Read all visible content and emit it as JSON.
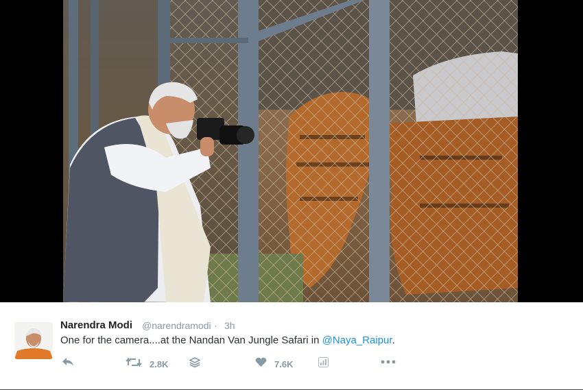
{
  "tweet": {
    "author_name": "Narendra Modi",
    "handle": "@narendramodi",
    "separator": "·",
    "time": "3h",
    "text_before": "One for the camera....at the Nandan Van Jungle Safari in ",
    "mention": "@Naya_Raipur",
    "text_after": ".",
    "retweet_count": "2.8K",
    "like_count": "7.6K"
  },
  "icons": {
    "reply": "reply-icon",
    "retweet": "retweet-icon",
    "stack": "stack-icon",
    "like": "heart-icon",
    "analytics": "analytics-icon",
    "more": "more-icon"
  },
  "colors": {
    "mention": "#1b95e0",
    "muted": "#8899a6",
    "count": "#aab8c2"
  }
}
